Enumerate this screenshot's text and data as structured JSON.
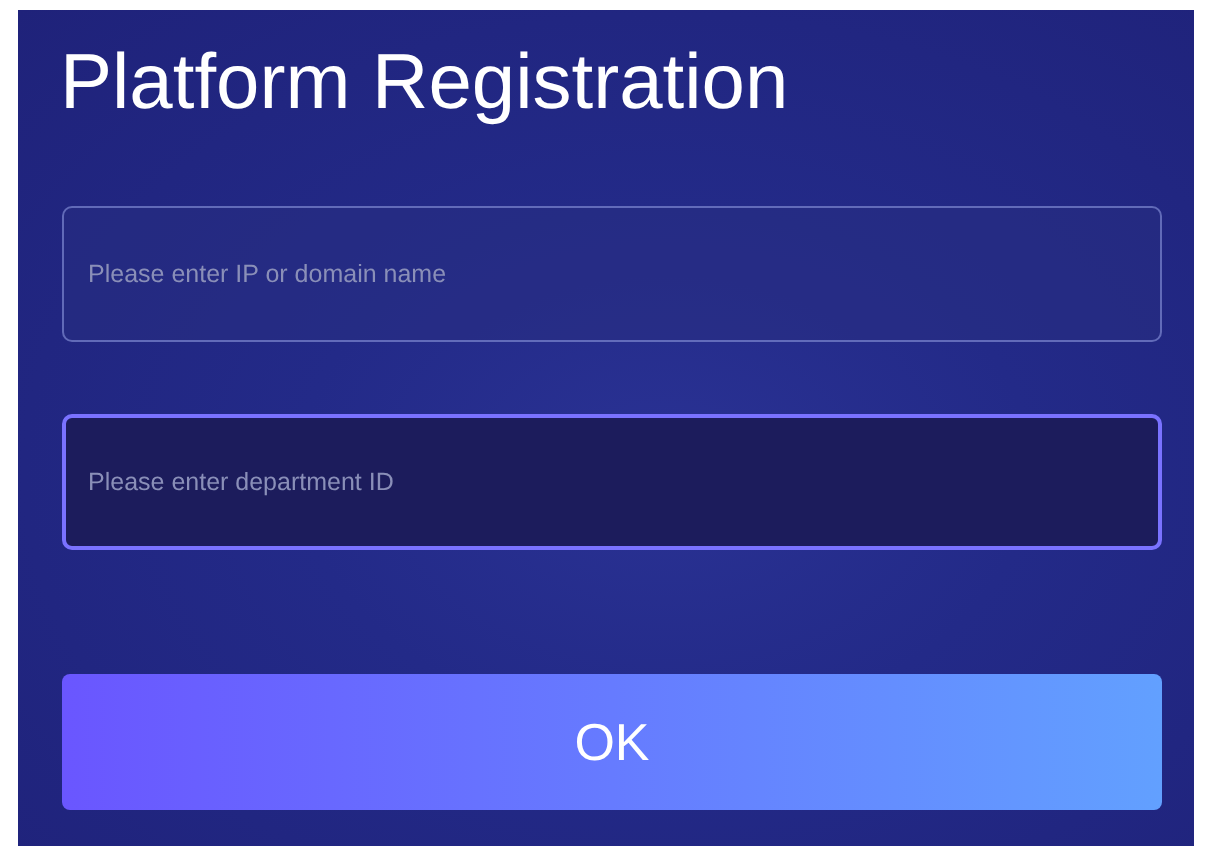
{
  "title": "Platform Registration",
  "fields": [
    {
      "placeholder": "Please enter IP or domain name",
      "focused": false
    },
    {
      "placeholder": "Please enter department ID",
      "focused": true
    }
  ],
  "button": {
    "label": "OK"
  }
}
